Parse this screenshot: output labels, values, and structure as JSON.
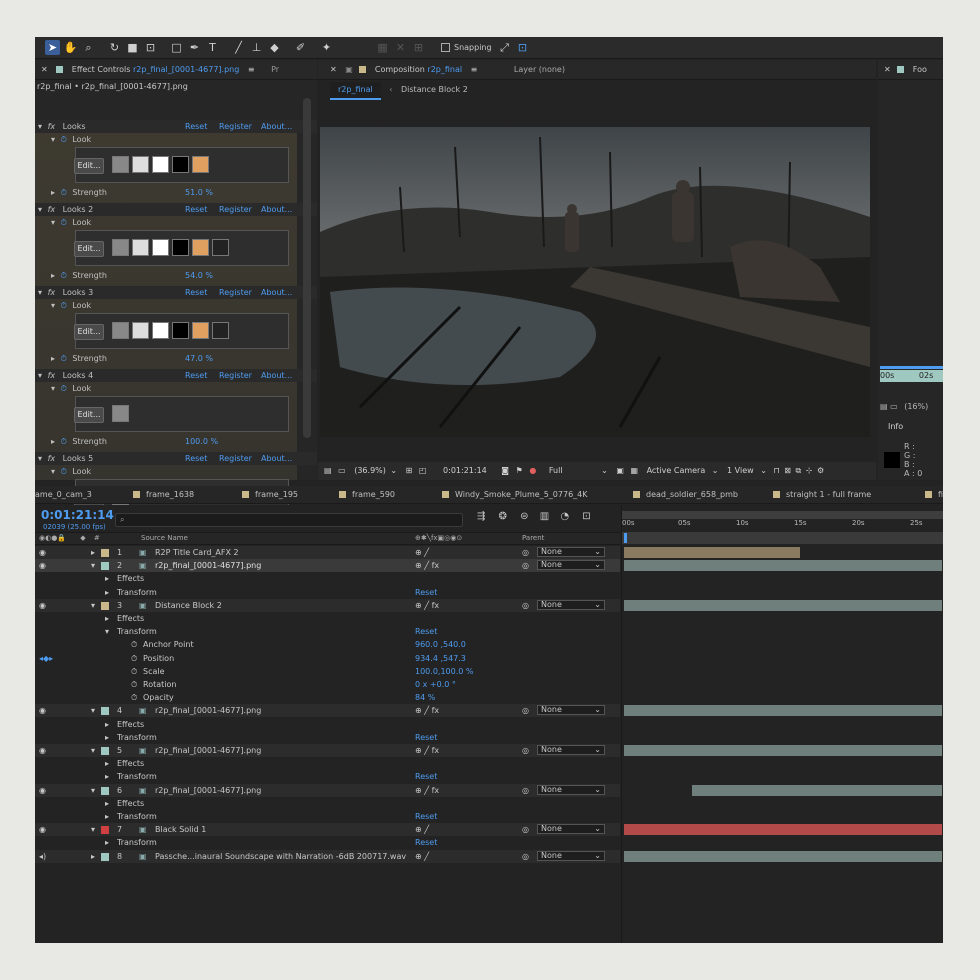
{
  "toolbar": {
    "snapping_label": "Snapping"
  },
  "effect_controls": {
    "tab_label": "Effect Controls",
    "tab_file": "r2p_final_[0001-4677].png",
    "tab_pr": "Pr",
    "breadcrumb": "r2p_final • r2p_final_[0001-4677].png",
    "links": {
      "reset": "Reset",
      "register": "Register",
      "about": "About..."
    },
    "look_label": "Look",
    "edit_label": "Edit...",
    "strength_label": "Strength",
    "effects": [
      {
        "name": "Looks",
        "strength": "51.0 %"
      },
      {
        "name": "Looks 2",
        "strength": "54.0 %"
      },
      {
        "name": "Looks 3",
        "strength": "47.0 %"
      },
      {
        "name": "Looks 4",
        "strength": "100.0 %"
      },
      {
        "name": "Looks 5"
      }
    ]
  },
  "composition": {
    "tab_label": "Composition",
    "tab_name": "r2p_final",
    "layer_tab": "Layer (none)",
    "crumbs": [
      "r2p_final",
      "Distance Block 2"
    ],
    "footer": {
      "zoom": "(36.9%)",
      "timecode": "0:01:21:14",
      "resolution": "Full",
      "camera": "Active Camera",
      "views": "1 View"
    }
  },
  "right_panel": {
    "tab": "Foo",
    "ruler_a": "00s",
    "ruler_b": "02s",
    "zoom": "(16%)",
    "info_title": "Info",
    "rgba": [
      "R :",
      "G :",
      "B :",
      "A : 0"
    ]
  },
  "timeline_tabs": [
    "ame_0_cam_3",
    "frame_1638",
    "frame_195",
    "frame_590",
    "Windy_Smoke_Plume_5_0776_4K",
    "dead_soldier_658_pmb",
    "straight 1 - full frame",
    "fi"
  ],
  "timeline": {
    "timecode": "0:01:21:14",
    "frames": "02039 (25.00 fps)",
    "search_placeholder": "",
    "col_source": "Source Name",
    "col_parent": "Parent",
    "ruler": [
      "00s",
      "05s",
      "10s",
      "15s",
      "20s",
      "25s"
    ],
    "layers": [
      {
        "num": "1",
        "name": "R2P Title Card_AFX 2",
        "parent": "None"
      },
      {
        "num": "2",
        "name": "r2p_final_[0001-4677].png",
        "parent": "None"
      },
      {
        "num": "3",
        "name": "Distance Block 2",
        "parent": "None"
      },
      {
        "num": "4",
        "name": "r2p_final_[0001-4677].png",
        "parent": "None"
      },
      {
        "num": "5",
        "name": "r2p_final_[0001-4677].png",
        "parent": "None"
      },
      {
        "num": "6",
        "name": "r2p_final_[0001-4677].png",
        "parent": "None"
      },
      {
        "num": "7",
        "name": "Black Solid 1",
        "parent": "None"
      },
      {
        "num": "8",
        "name": "Passche...inaural Soundscape with Narration -6dB 200717.wav",
        "parent": "None"
      }
    ],
    "sub": {
      "effects": "Effects",
      "transform": "Transform",
      "reset": "Reset",
      "anchor_point": "Anchor Point",
      "anchor_val": "960.0 ,540.0",
      "position": "Position",
      "position_val": "934.4 ,547.3",
      "scale": "Scale",
      "scale_val": "100.0,100.0 %",
      "rotation": "Rotation",
      "rotation_val": "0 x +0.0 °",
      "opacity": "Opacity",
      "opacity_val": "84 %"
    }
  },
  "colors": {
    "accent": "#4e9cf0",
    "solid": "#b34a4a",
    "bar": "#6f7f7b"
  }
}
